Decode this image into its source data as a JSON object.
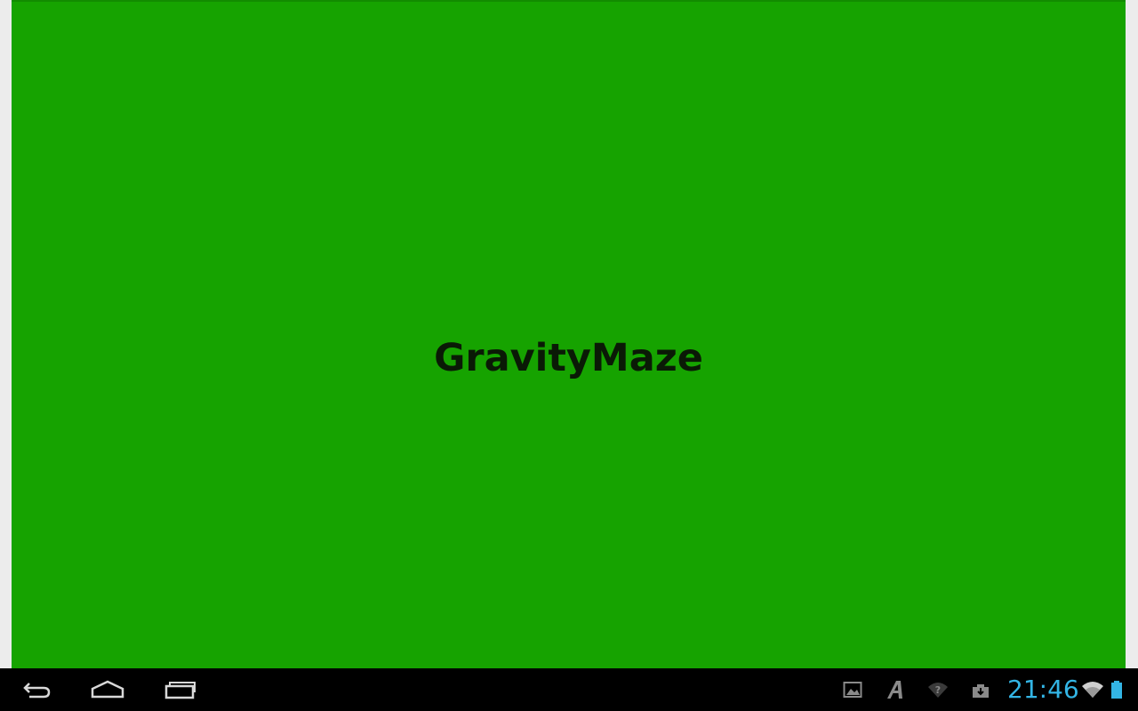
{
  "app": {
    "title": "GravityMaze",
    "background_color": "#16a300",
    "title_color": "#0a1a06"
  },
  "navbar": {
    "back_icon": "back-icon",
    "home_icon": "home-icon",
    "recents_icon": "recent-apps-icon"
  },
  "status_bar": {
    "icons": [
      "gallery-notification-icon",
      "font-a-notification-icon",
      "wifi-question-icon",
      "download-notification-icon"
    ],
    "time": "21:46",
    "accent_color": "#33b5e5",
    "wifi_icon": "wifi-icon",
    "battery_icon": "battery-icon"
  }
}
